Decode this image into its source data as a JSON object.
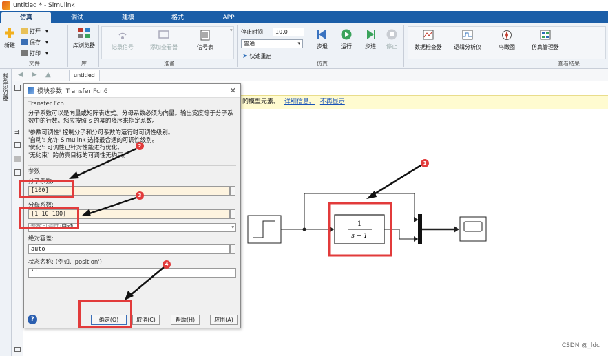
{
  "window": {
    "title": "untitled * - Simulink"
  },
  "tabs": [
    {
      "label": "仿真",
      "active": true
    },
    {
      "label": "调试",
      "active": false
    },
    {
      "label": "建模",
      "active": false
    },
    {
      "label": "格式",
      "active": false
    },
    {
      "label": "APP",
      "active": false
    }
  ],
  "ribbon": {
    "file": {
      "new": "新建",
      "open": "打开",
      "save": "保存",
      "print": "打印",
      "group": "文件"
    },
    "library": {
      "browser": "库浏览器",
      "group": "库"
    },
    "prepare": {
      "log_signal": "记录信号",
      "add_viewer": "添加查看器",
      "signal_table": "信号表",
      "group": "准备"
    },
    "simulate": {
      "stop_time_label": "停止时间",
      "stop_time_value": "10.0",
      "mode_value": "普通",
      "fast_restart": "快速重启",
      "step_back": "步退",
      "run": "运行",
      "step_forward": "步进",
      "stop": "停止",
      "group": "仿真"
    },
    "review": {
      "data_inspector": "数据检查器",
      "logic_analyzer": "逻辑分析仪",
      "bird_eye": "鸟瞰图",
      "sim_manager": "仿真管理器",
      "group": "查看结果"
    }
  },
  "sidebar": {
    "vertical_label": "模型浏览器"
  },
  "editor": {
    "doc_tab": "untitled"
  },
  "message_bar": {
    "text": "的模型元素。",
    "link1": "详细信息。",
    "link2": "不再显示"
  },
  "dialog": {
    "title": "模块参数: Transfer Fcn6",
    "block_type": "Transfer Fcn",
    "description": [
      "分子系数可以是向量或矩阵表达式。分母系数必须为向量。输出宽度等于分子系数中的行数。您应按照 s 的幂的降序来指定系数。",
      "",
      "'参数可调性' 控制分子和分母系数的运行时可调性级别。",
      "'自动': 允许 Simulink 选择最合适的可调性级别。",
      "'优化': 可调性已针对性能进行优化。",
      "'无约束': 跨仿真目标的可调性无约束。"
    ],
    "params_header": "参数",
    "numerator_label": "分子系数:",
    "numerator_value": "[100]",
    "denominator_label": "分母系数:",
    "denominator_value": "[1 10 100]",
    "tunability_label": "参数可调性:",
    "tunability_value": "自动",
    "abs_tol_label": "绝对容差:",
    "abs_tol_value": "auto",
    "state_name_label": "状态名称: (例如, 'position')",
    "state_name_value": "''",
    "buttons": {
      "ok": "确定(O)",
      "cancel": "取消(C)",
      "help": "帮助(H)",
      "apply": "应用(A)"
    }
  },
  "diagram": {
    "tf_numerator": "1",
    "tf_denominator": "s + 1"
  },
  "annotations": [
    "1",
    "2",
    "3",
    "4"
  ],
  "watermark": "CSDN @_ldc",
  "colors": {
    "tab_bar": "#1b5ea8",
    "annotation": "#e23b3b",
    "warning_bar": "#fffbd0"
  }
}
